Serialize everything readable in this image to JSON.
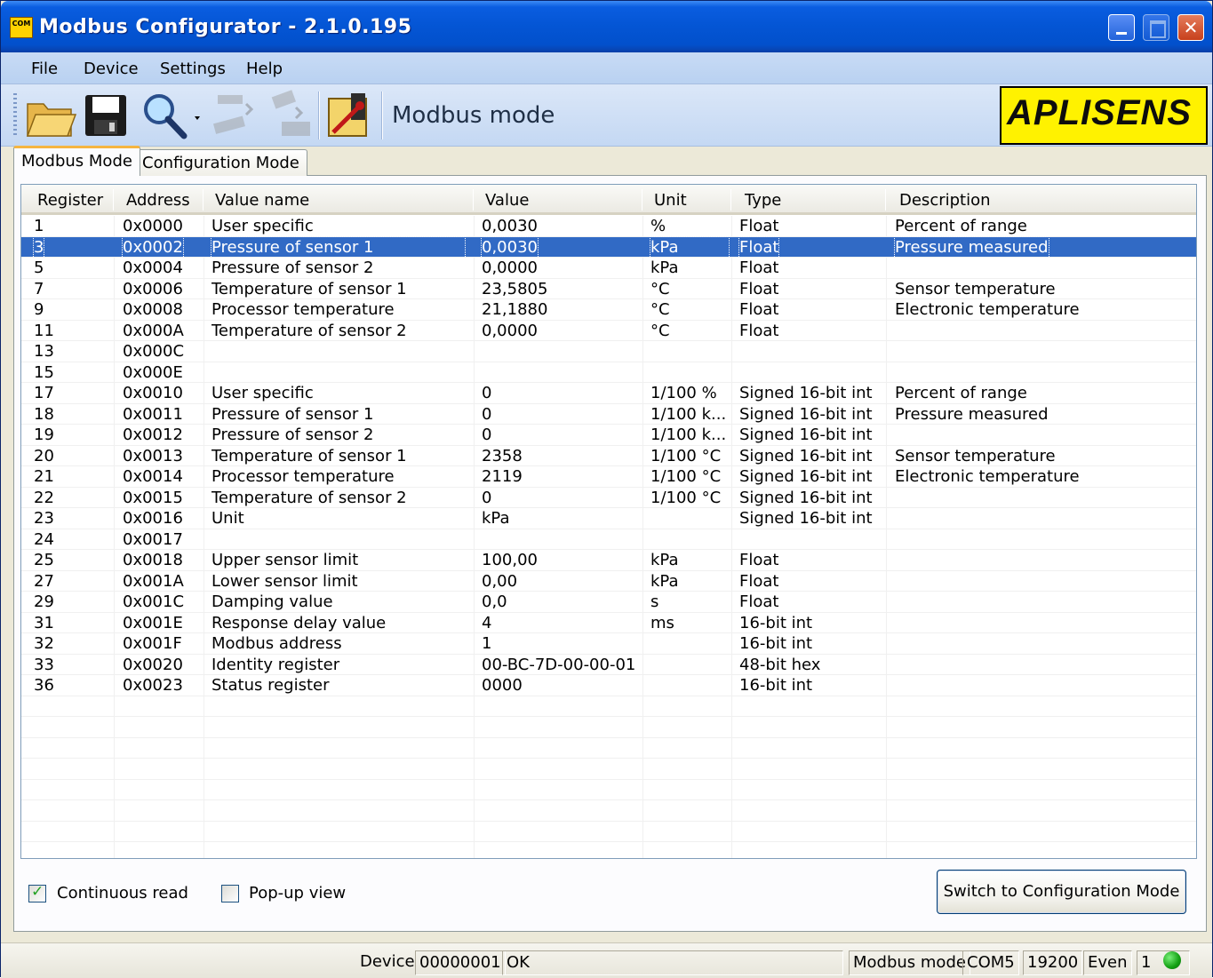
{
  "window": {
    "title": "Modbus Configurator - 2.1.0.195",
    "icon_text": "COM"
  },
  "menu": [
    "File",
    "Device",
    "Settings",
    "Help"
  ],
  "toolbar": {
    "mode_label": "Modbus mode",
    "brand": "APLISENS"
  },
  "tabs": [
    {
      "label": "Modbus Mode",
      "active": true
    },
    {
      "label": "Configuration Mode",
      "active": false
    }
  ],
  "table": {
    "columns": [
      "Register",
      "Address",
      "Value name",
      "Value",
      "Unit",
      "Type",
      "Description"
    ],
    "selected_row": 1,
    "rows": [
      [
        "1",
        "0x0000",
        "User specific",
        "0,0030",
        "%",
        "Float",
        "Percent of range"
      ],
      [
        "3",
        "0x0002",
        "Pressure of sensor 1",
        "0,0030",
        "kPa",
        "Float",
        "Pressure measured"
      ],
      [
        "5",
        "0x0004",
        "Pressure of sensor 2",
        "0,0000",
        "kPa",
        "Float",
        ""
      ],
      [
        "7",
        "0x0006",
        "Temperature of sensor 1",
        "23,5805",
        "°C",
        "Float",
        "Sensor temperature"
      ],
      [
        "9",
        "0x0008",
        "Processor temperature",
        "21,1880",
        "°C",
        "Float",
        "Electronic temperature"
      ],
      [
        "11",
        "0x000A",
        "Temperature of sensor 2",
        "0,0000",
        "°C",
        "Float",
        ""
      ],
      [
        "13",
        "0x000C",
        "",
        "",
        "",
        "",
        ""
      ],
      [
        "15",
        "0x000E",
        "",
        "",
        "",
        "",
        ""
      ],
      [
        "17",
        "0x0010",
        "User specific",
        "0",
        "1/100 %",
        "Signed 16-bit int",
        "Percent of range"
      ],
      [
        "18",
        "0x0011",
        "Pressure of sensor 1",
        "0",
        "1/100 k...",
        "Signed 16-bit int",
        "Pressure measured"
      ],
      [
        "19",
        "0x0012",
        "Pressure of sensor 2",
        "0",
        "1/100 k...",
        "Signed 16-bit int",
        ""
      ],
      [
        "20",
        "0x0013",
        "Temperature of sensor 1",
        "2358",
        "1/100 °C",
        "Signed 16-bit int",
        "Sensor temperature"
      ],
      [
        "21",
        "0x0014",
        "Processor temperature",
        "2119",
        "1/100 °C",
        "Signed 16-bit int",
        "Electronic temperature"
      ],
      [
        "22",
        "0x0015",
        "Temperature of sensor 2",
        "0",
        "1/100 °C",
        "Signed 16-bit int",
        ""
      ],
      [
        "23",
        "0x0016",
        "Unit",
        "kPa",
        "",
        "Signed 16-bit int",
        ""
      ],
      [
        "24",
        "0x0017",
        "",
        "",
        "",
        "",
        ""
      ],
      [
        "25",
        "0x0018",
        "Upper sensor limit",
        "100,00",
        "kPa",
        "Float",
        ""
      ],
      [
        "27",
        "0x001A",
        "Lower sensor limit",
        "0,00",
        "kPa",
        "Float",
        ""
      ],
      [
        "29",
        "0x001C",
        "Damping value",
        "0,0",
        "s",
        "Float",
        ""
      ],
      [
        "31",
        "0x001E",
        "Response delay value",
        "4",
        "ms",
        "16-bit int",
        ""
      ],
      [
        "32",
        "0x001F",
        "Modbus address",
        "1",
        "",
        "16-bit int",
        ""
      ],
      [
        "33",
        "0x0020",
        "Identity register",
        "00-BC-7D-00-00-01",
        "",
        "48-bit hex",
        ""
      ],
      [
        "36",
        "0x0023",
        "Status register",
        "0000",
        "",
        "16-bit int",
        ""
      ]
    ]
  },
  "options": {
    "continuous_read": {
      "label": "Continuous read",
      "checked": true
    },
    "popup_view": {
      "label": "Pop-up view",
      "checked": false
    }
  },
  "switch_button": "Switch to Configuration Mode",
  "status": {
    "device_label": "Device",
    "device_id": "00000001",
    "state": "OK",
    "mode": "Modbus mode",
    "port": "COM5",
    "baud": "19200",
    "parity": "Even",
    "stop_bits": "1",
    "led_color": "#12a012"
  }
}
